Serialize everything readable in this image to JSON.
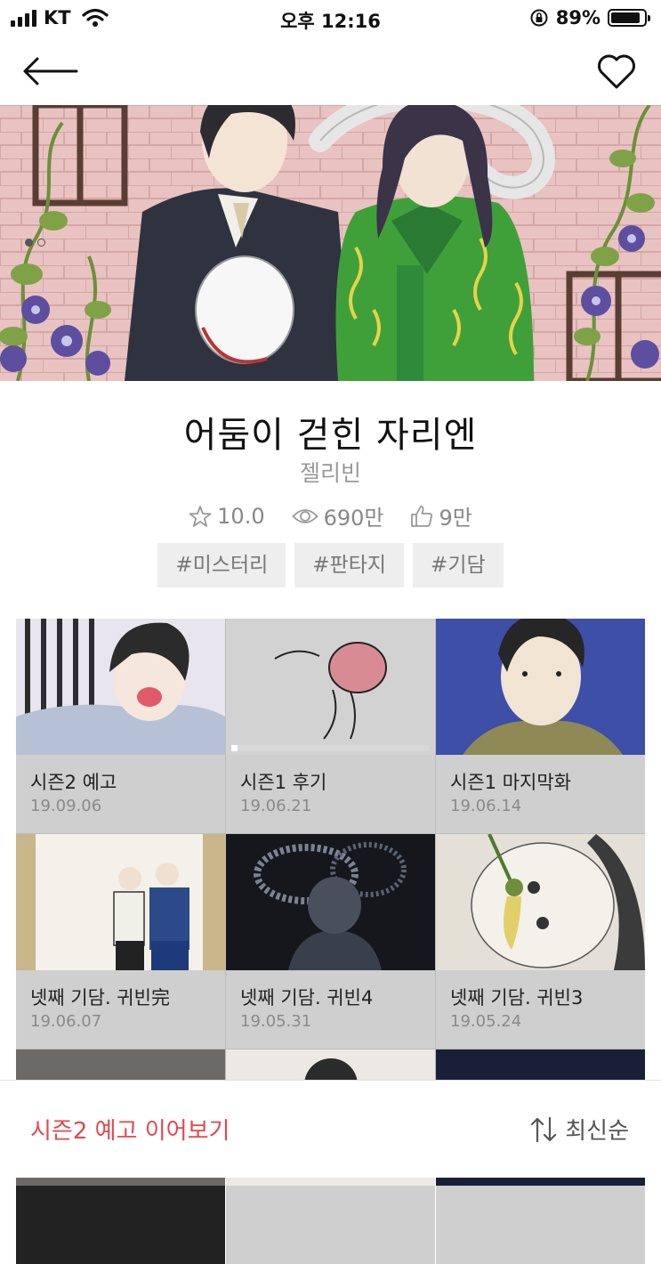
{
  "status_bar": {
    "carrier": "KT",
    "time": "오후 12:16",
    "battery_text": "89%",
    "battery_level": 0.89
  },
  "hero": {
    "pager_count": 2,
    "pager_active": 0
  },
  "series": {
    "title": "어둠이 걷힌 자리엔",
    "author": "젤리빈",
    "rating": "10.0",
    "views": "690만",
    "likes": "9만",
    "tags": [
      "#미스터리",
      "#판타지",
      "#기담"
    ]
  },
  "episodes": [
    {
      "title": "시즌2 예고",
      "date": "19.09.06"
    },
    {
      "title": "시즌1 후기",
      "date": "19.06.21",
      "progress": 0.03
    },
    {
      "title": "시즌1 마지막화",
      "date": "19.06.14"
    },
    {
      "title": "넷째 기담. 귀빈完",
      "date": "19.06.07"
    },
    {
      "title": "넷째 기담. 귀빈4",
      "date": "19.05.31"
    },
    {
      "title": "넷째 기담. 귀빈3",
      "date": "19.05.24"
    }
  ],
  "bottom_bar": {
    "continue_label": "시즌2 예고 이어보기",
    "sort_label": "최신순"
  },
  "colors": {
    "accent": "#e5484d",
    "hero_bg": "#e9c6c6",
    "hanbok_green": "#3fa03a",
    "tag_bg": "#eeeeee"
  }
}
